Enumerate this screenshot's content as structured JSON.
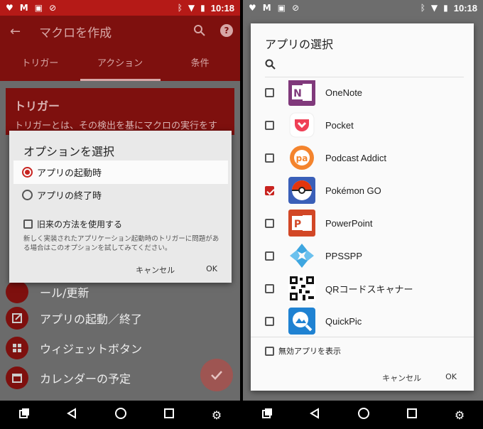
{
  "left": {
    "status": {
      "time": "10:18"
    },
    "appbar": {
      "title": "マクロを作成"
    },
    "tabs": [
      "トリガー",
      "アクション",
      "条件"
    ],
    "card": {
      "heading": "トリガー",
      "text": "トリガーとは、その検出を基にマクロの実行をす"
    },
    "list_items": [
      "ール/更新",
      "アプリの起動／終了",
      "ウィジェットボタン",
      "カレンダーの予定"
    ],
    "dialog": {
      "title": "オプションを選択",
      "options": [
        "アプリの起動時",
        "アプリの終了時"
      ],
      "selected_index": 0,
      "legacy_label": "旧来の方法を使用する",
      "note": "新しく実装されたアプリケーション起動時のトリガーに問題がある場合はこのオプションを試してみてください。",
      "cancel": "キャンセル",
      "ok": "OK"
    }
  },
  "right": {
    "status": {
      "time": "10:18"
    },
    "dialog": {
      "title": "アプリの選択",
      "apps": [
        {
          "name": "OneNote",
          "checked": false,
          "icon": "onenote-icon",
          "color": "#80397b"
        },
        {
          "name": "Pocket",
          "checked": false,
          "icon": "pocket-icon",
          "color": "#ef4056"
        },
        {
          "name": "Podcast Addict",
          "checked": false,
          "icon": "podcast-addict-icon",
          "color": "#f4842d"
        },
        {
          "name": "Pokémon GO",
          "checked": true,
          "icon": "pokemon-go-icon",
          "color": "#3a5fb8"
        },
        {
          "name": "PowerPoint",
          "checked": false,
          "icon": "powerpoint-icon",
          "color": "#d24726"
        },
        {
          "name": "PPSSPP",
          "checked": false,
          "icon": "ppsspp-icon",
          "color": "#3ea6e0"
        },
        {
          "name": "QRコードスキャナー",
          "checked": false,
          "icon": "qr-scanner-icon",
          "color": "#111111"
        },
        {
          "name": "QuickPic",
          "checked": false,
          "icon": "quickpic-icon",
          "color": "#1f82d2"
        }
      ],
      "show_disabled_label": "無効アプリを表示",
      "cancel": "キャンセル",
      "ok": "OK"
    }
  }
}
